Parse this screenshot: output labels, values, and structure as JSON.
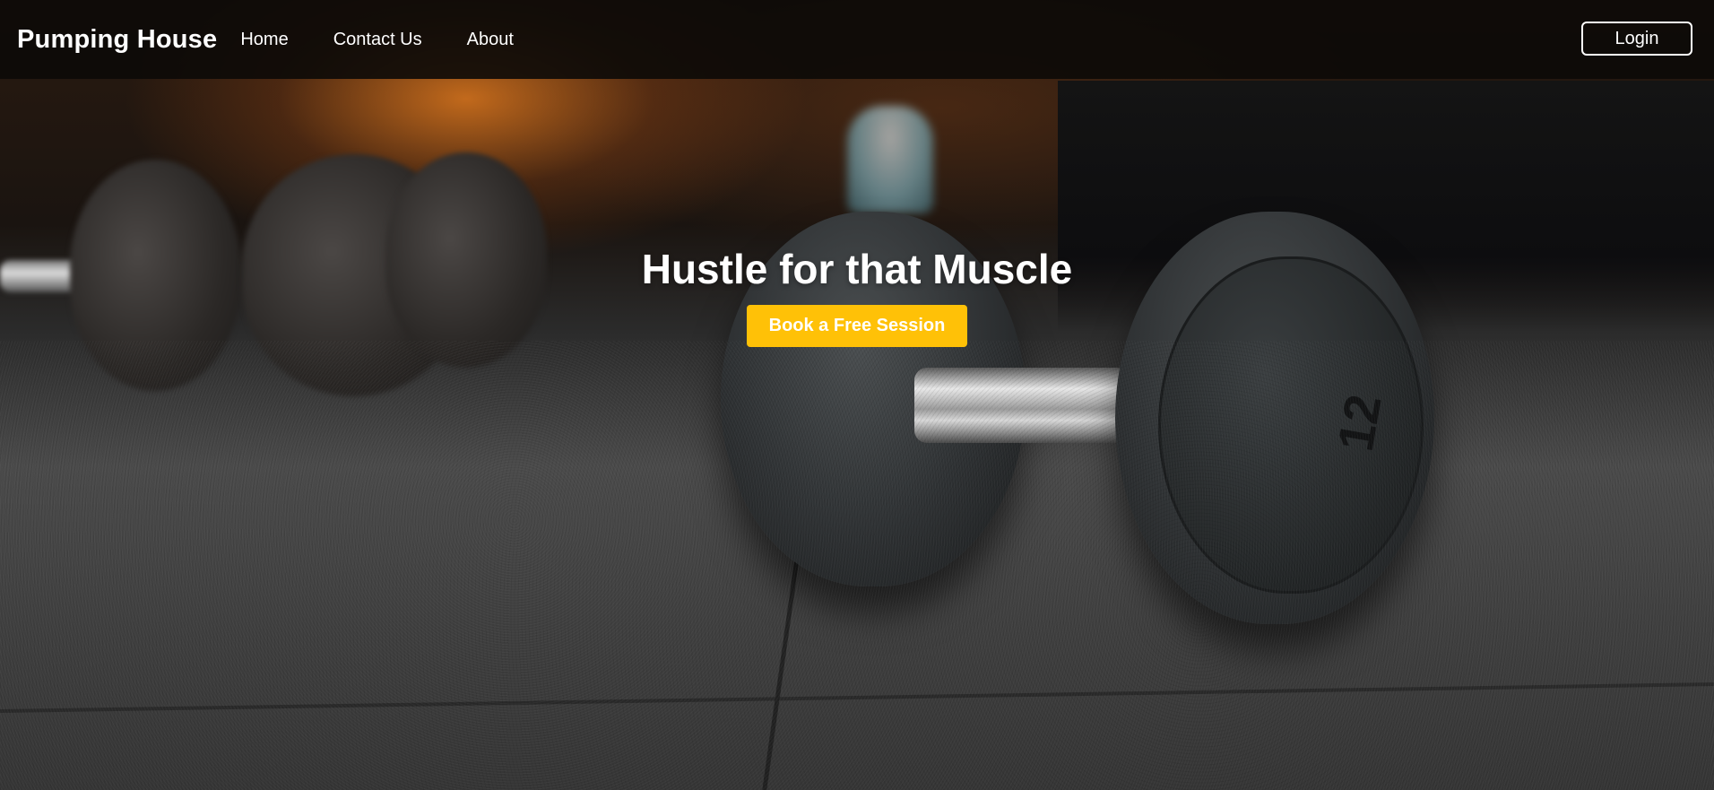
{
  "navbar": {
    "brand": "Pumping House",
    "links": [
      {
        "label": "Home"
      },
      {
        "label": "Contact Us"
      },
      {
        "label": "About"
      }
    ],
    "login_label": "Login"
  },
  "hero": {
    "title": "Hustle for that Muscle",
    "cta_label": "Book a Free Session",
    "background_image": "gym dumbbells on rubber floor"
  },
  "colors": {
    "navbar_bg": "#0c0a08",
    "cta_bg": "#ffc107",
    "text": "#ffffff"
  }
}
